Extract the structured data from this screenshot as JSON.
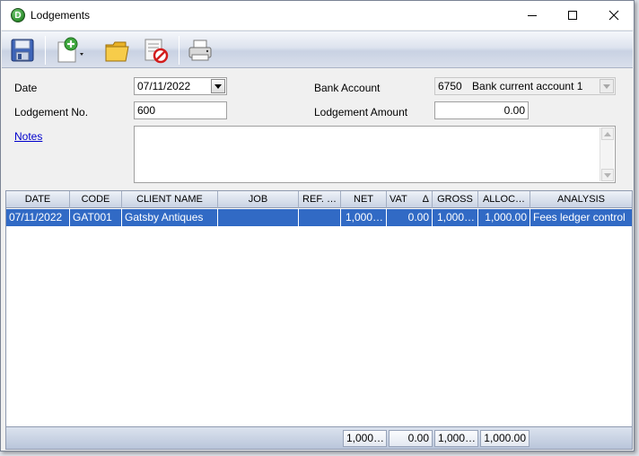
{
  "window": {
    "title": "Lodgements",
    "app_icon_letter": "D"
  },
  "toolbar": {
    "buttons": [
      {
        "name": "save-icon"
      },
      {
        "name": "new-document-icon"
      },
      {
        "name": "open-folder-icon"
      },
      {
        "name": "cancel-document-icon"
      },
      {
        "name": "print-icon"
      }
    ]
  },
  "form": {
    "date_label": "Date",
    "date_value": "07/11/2022",
    "lodgement_no_label": "Lodgement No.",
    "lodgement_no_value": "600",
    "notes_label": "Notes",
    "notes_value": "",
    "bank_account_label": "Bank Account",
    "bank_account_code": "6750",
    "bank_account_name": "Bank current account 1",
    "lodgement_amount_label": "Lodgement Amount",
    "lodgement_amount_value": "0.00"
  },
  "grid": {
    "columns": [
      "DATE",
      "CODE",
      "CLIENT NAME",
      "JOB",
      "REF. …",
      "NET",
      "VAT",
      "GROSS",
      "ALLOC…",
      "ANALYSIS"
    ],
    "vat_sort_indicator": "Δ",
    "rows": [
      {
        "date": "07/11/2022",
        "code": "GAT001",
        "client_name": "Gatsby Antiques",
        "job": "",
        "ref": "",
        "net": "1,000…",
        "vat": "0.00",
        "gross": "1,000…",
        "alloc": "1,000.00",
        "analysis": "Fees ledger control"
      }
    ],
    "totals": {
      "net": "1,000…",
      "vat": "0.00",
      "gross": "1,000…",
      "alloc": "1,000.00"
    }
  },
  "colors": {
    "selection": "#316ac5",
    "toolbar": "#d9dfeb",
    "link": "#0000cc"
  }
}
